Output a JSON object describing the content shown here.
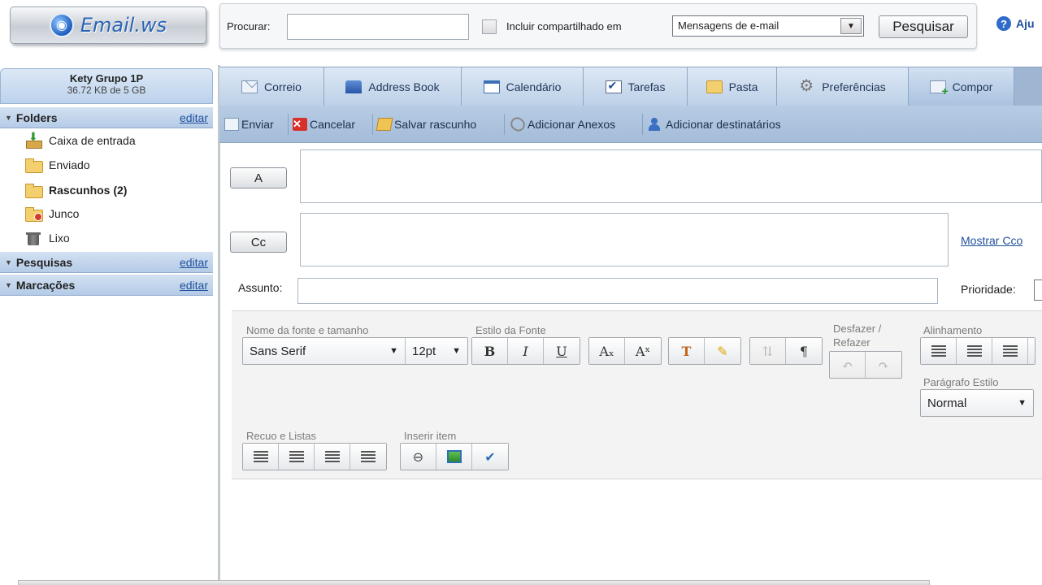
{
  "logo": {
    "brand": "Email.ws",
    "icon": "globe-icon"
  },
  "search": {
    "label": "Procurar:",
    "input_value": "",
    "include_shared_label": "Incluir compartilhado  em",
    "scope_selected": "Mensagens de e-mail",
    "button_label": "Pesquisar",
    "help_label": "Aju"
  },
  "account": {
    "name": "Kety Grupo 1P",
    "quota": "36.72 KB de 5 GB"
  },
  "sidebar": {
    "folders_title": "Folders",
    "folders_edit": "editar",
    "folders": [
      {
        "label": "Caixa de entrada",
        "icon": "inbox-icon",
        "bold": false
      },
      {
        "label": "Enviado",
        "icon": "sent-folder-icon",
        "bold": false
      },
      {
        "label": "Rascunhos (2)",
        "icon": "drafts-folder-icon",
        "bold": true
      },
      {
        "label": "Junco",
        "icon": "junk-folder-icon",
        "bold": false
      },
      {
        "label": "Lixo",
        "icon": "trash-icon",
        "bold": false
      }
    ],
    "searches_title": "Pesquisas",
    "searches_edit": "editar",
    "tags_title": "Marcações",
    "tags_edit": "editar"
  },
  "tabs": [
    {
      "label": "Correio",
      "icon": "mail-icon"
    },
    {
      "label": "Address Book",
      "icon": "address-book-icon"
    },
    {
      "label": "Calendário",
      "icon": "calendar-icon"
    },
    {
      "label": "Tarefas",
      "icon": "tasks-icon"
    },
    {
      "label": "Pasta",
      "icon": "folder-icon"
    },
    {
      "label": "Preferências",
      "icon": "gear-icon"
    },
    {
      "label": "Compor",
      "icon": "compose-icon",
      "active": true
    }
  ],
  "actions": {
    "send": "Enviar",
    "cancel": "Cancelar",
    "save_draft": "Salvar rascunho",
    "attach": "Adicionar Anexos",
    "add_recipients": "Adicionar destinatários"
  },
  "compose": {
    "to_button": "A",
    "to_value": "",
    "cc_button": "Cc",
    "cc_value": "",
    "show_bcc": "Mostrar Cco",
    "subject_label": "Assunto:",
    "subject_value": "",
    "priority_label": "Prioridade:"
  },
  "editor": {
    "font_group_label": "Nome da fonte e tamanho",
    "font_name": "Sans Serif",
    "font_size": "12pt",
    "style_group_label": "Estilo da Fonte",
    "bold": "B",
    "italic": "I",
    "underline": "U",
    "subscript": "Aₓ",
    "superscript": "Aˣ",
    "paragraph_mark": "¶",
    "undo_group_label_1": "Desfazer /",
    "undo_group_label_2": "Refazer",
    "align_group_label": "Alinhamento",
    "paragraph_style_label": "Parágrafo Estilo",
    "paragraph_style_value": "Normal",
    "indent_group_label": "Recuo e Listas",
    "insert_group_label": "Inserir item"
  },
  "colors": {
    "accent": "#1f4f9c",
    "tab_bar": "#9eb6d2",
    "cancel_red": "#d8302a"
  }
}
